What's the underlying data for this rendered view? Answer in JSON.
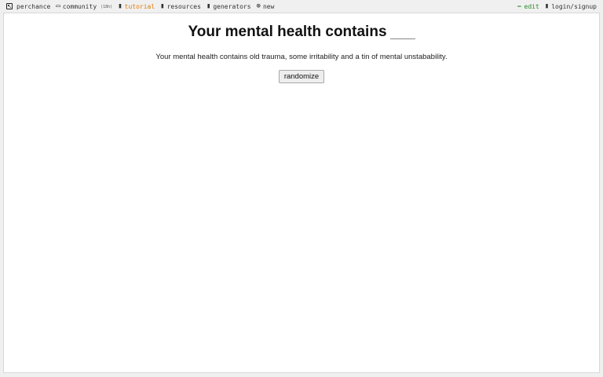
{
  "nav": {
    "left": {
      "perchance": "perchance",
      "community": "community",
      "community_badge": "(18h)",
      "tutorial": "tutorial",
      "resources": "resources",
      "generators": "generators",
      "new": "new"
    },
    "right": {
      "edit": "edit",
      "login": "login/signup"
    },
    "icons": {
      "perchance": "dice-icon",
      "community": "chat-icon",
      "tutorial": "book-icon",
      "resources": "folder-icon",
      "generators": "grid-icon",
      "new": "plus-circle-icon",
      "edit": "pencil-icon",
      "login": "user-icon"
    },
    "colors": {
      "tutorial": "#e07b10",
      "edit": "#2a8a2a"
    }
  },
  "main": {
    "title": "Your mental health contains",
    "output": "Your mental health contains old trauma, some irritability and a tin of mental unstabability.",
    "randomize_label": "randomize"
  }
}
